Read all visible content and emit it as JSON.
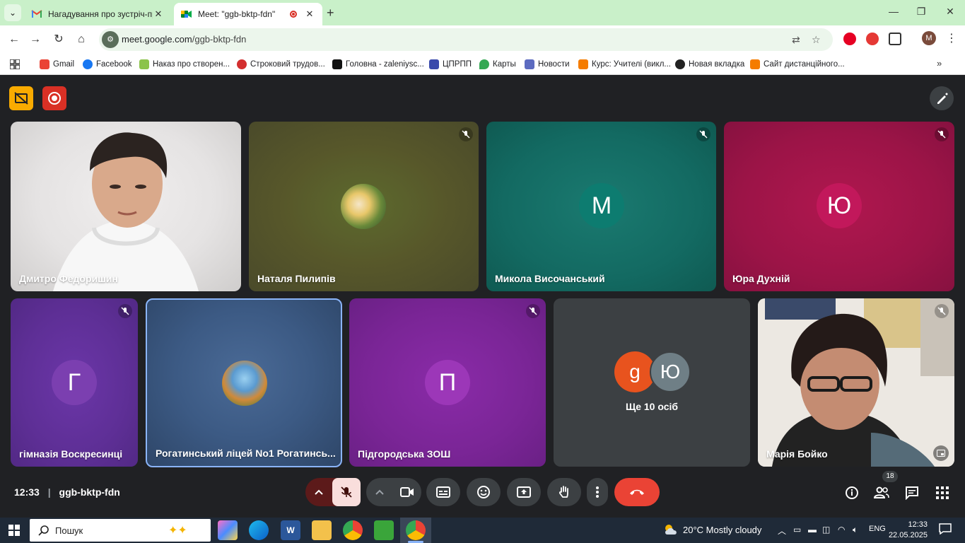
{
  "browser": {
    "tabs": [
      {
        "title": "Нагадування про зустріч-пре",
        "active": false
      },
      {
        "title": "Meet: \"ggb-bktp-fdn\"",
        "active": true
      }
    ],
    "url_domain": "meet.google.com",
    "url_path": "/ggb-bktp-fdn",
    "profile_initial": "M",
    "bookmarks": [
      "Gmail",
      "Facebook",
      "Наказ про створен...",
      "Строковий трудов...",
      "Головна - zaleniysc...",
      "ЦПРПП",
      "Карты",
      "Новости",
      "Курс: Учителі (викл...",
      "Новая вкладка",
      "Сайт дистанційного..."
    ]
  },
  "meet": {
    "tiles_row1": [
      {
        "name": "Дмитро Федоришин",
        "type": "video"
      },
      {
        "name": "Наталя Пилипів",
        "type": "photo",
        "muted": true
      },
      {
        "name": "Микола Височанський",
        "type": "initial",
        "initial": "M",
        "muted": true
      },
      {
        "name": "Юра Духній",
        "type": "initial",
        "initial": "Ю",
        "muted": true
      }
    ],
    "tiles_row2": [
      {
        "name": "гімназія Воскресинці",
        "type": "initial",
        "initial": "Г",
        "muted": true
      },
      {
        "name": "Рогатинський ліцей No1 Рогатинсь...",
        "type": "photo"
      },
      {
        "name": "Підгородська ЗОШ",
        "type": "initial",
        "initial": "П",
        "muted": true
      },
      {
        "name": "Ще 10 осіб",
        "type": "others",
        "initials": [
          "g",
          "Ю"
        ]
      },
      {
        "name": "Марія Бойко",
        "type": "video",
        "muted": true
      }
    ],
    "time": "12:33",
    "meeting_code": "ggb-bktp-fdn",
    "participants_count": "18"
  },
  "taskbar": {
    "search_placeholder": "Пошук",
    "weather": "20°C  Mostly cloudy",
    "lang": "ENG",
    "time": "12:33",
    "date": "22.05.2025"
  },
  "colors": {
    "tab_strip": "#c9f0c9",
    "meet_bg": "#202124",
    "end_call": "#ea4335",
    "mic_off": "#f9dedc",
    "avatar_m": "#0d7c70",
    "avatar_yu": "#c2185b",
    "avatar_g": "#7b3fb0",
    "avatar_p": "#9c37b8"
  }
}
